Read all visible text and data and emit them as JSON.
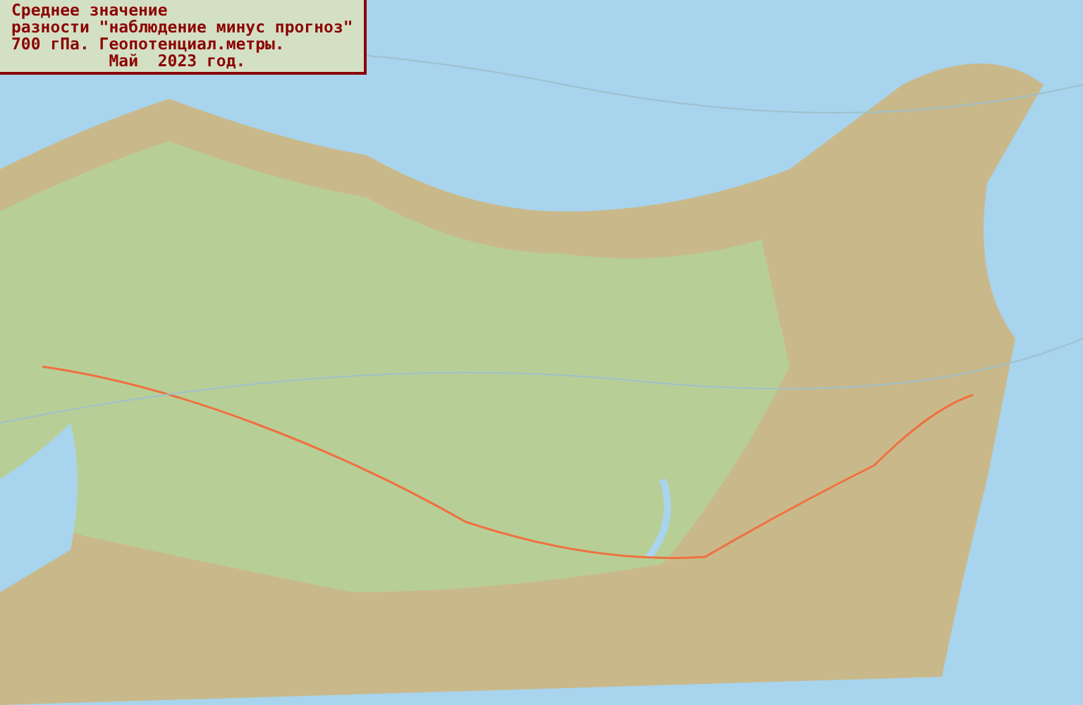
{
  "legend": {
    "lines": [
      "Среднее значение",
      "разности \"наблюдение минус прогноз\"",
      "700 гПа. Геопотенциал.метры.",
      "          Май  2023 год."
    ]
  }
}
